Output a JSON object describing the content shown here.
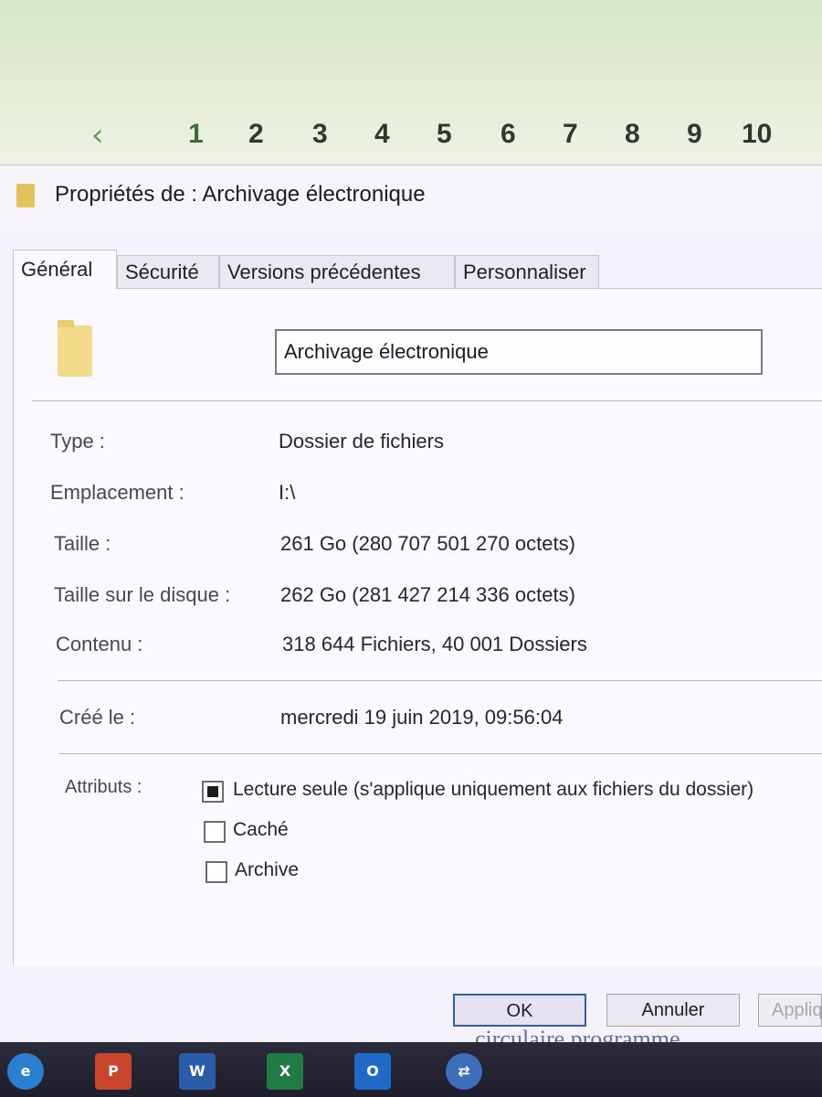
{
  "background_page": {
    "pager": {
      "back_icon": "chevron-left-icon",
      "pages": [
        "1",
        "2",
        "3",
        "4",
        "5",
        "6",
        "7",
        "8",
        "9",
        "10"
      ]
    },
    "footer_text": "circulaire programme"
  },
  "dialog": {
    "title": "Propriétés de : Archivage électronique",
    "tabs": [
      "Général",
      "Sécurité",
      "Versions précédentes",
      "Personnaliser"
    ],
    "active_tab": "Général",
    "name_value": "Archivage électronique",
    "properties": [
      {
        "label": "Type :",
        "value": "Dossier de fichiers"
      },
      {
        "label": "Emplacement :",
        "value": "I:\\"
      },
      {
        "label": "Taille :",
        "value": "261 Go (280 707 501 270 octets)"
      },
      {
        "label": "Taille sur le disque :",
        "value": "262 Go (281 427 214 336 octets)"
      },
      {
        "label": "Contenu :",
        "value": "318 644 Fichiers, 40 001 Dossiers"
      }
    ],
    "created": {
      "label": "Créé le :",
      "value": "mercredi 19 juin 2019, 09:56:04"
    },
    "attributes": {
      "label": "Attributs :",
      "items": [
        {
          "label": "Lecture seule (s'applique uniquement aux fichiers du dossier)",
          "state": "indeterminate"
        },
        {
          "label": "Caché",
          "state": "unchecked"
        },
        {
          "label": "Archive",
          "state": "unchecked"
        }
      ]
    },
    "buttons": {
      "ok": "OK",
      "cancel": "Annuler",
      "apply": "Appliquer"
    }
  },
  "colors": {
    "accent": "#2d5db8",
    "folder": "#f1da8a",
    "taskbar": "#24233a"
  },
  "taskbar_icons": [
    "ie-icon",
    "powerpoint-icon",
    "word-icon",
    "excel-icon",
    "outlook-icon",
    "network-icon"
  ]
}
